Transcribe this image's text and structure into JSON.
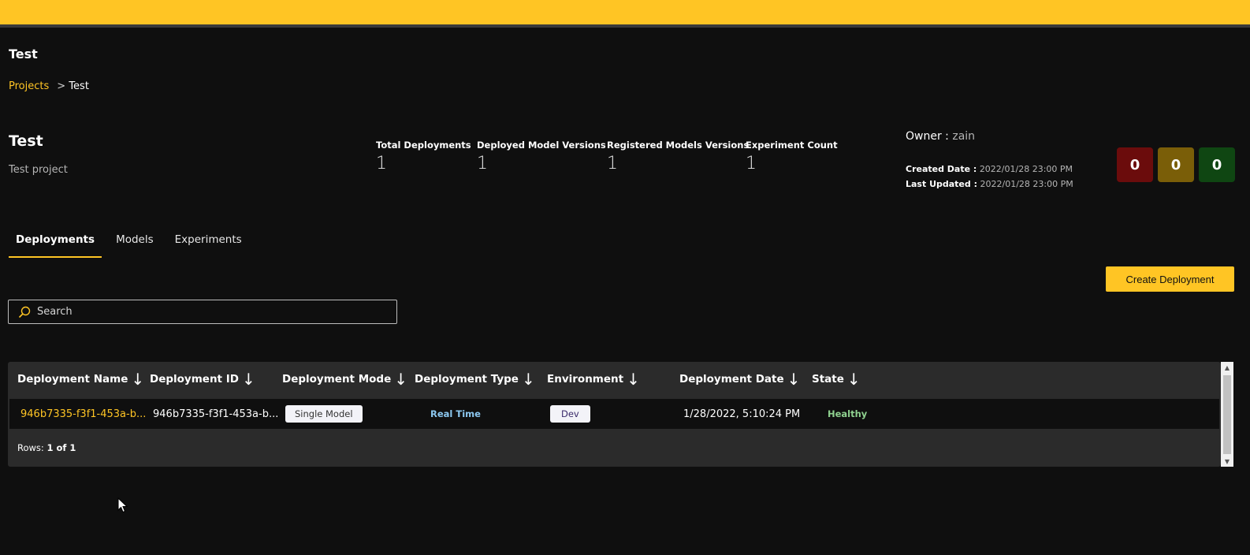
{
  "header": {
    "title": "Test"
  },
  "breadcrumb": {
    "link": "Projects",
    "separator": ">",
    "current": "Test"
  },
  "project": {
    "name": "Test",
    "description": "Test project"
  },
  "stats": [
    {
      "label": "Total Deployments",
      "value": "1"
    },
    {
      "label": "Deployed Model Versions",
      "value": "1"
    },
    {
      "label": "Registered Models Versions",
      "value": "1"
    },
    {
      "label": "Experiment Count",
      "value": "1"
    }
  ],
  "meta": {
    "owner_label": "Owner :",
    "owner_value": "zain",
    "created_label": "Created Date :",
    "created_value": "2022/01/28 23:00 PM",
    "updated_label": "Last Updated :",
    "updated_value": "2022/01/28 23:00 PM"
  },
  "badges": [
    {
      "value": "0",
      "color": "#6b0c0c"
    },
    {
      "value": "0",
      "color": "#7a5e08"
    },
    {
      "value": "0",
      "color": "#0f4612"
    }
  ],
  "tabs": [
    {
      "label": "Deployments",
      "active": true
    },
    {
      "label": "Models",
      "active": false
    },
    {
      "label": "Experiments",
      "active": false
    }
  ],
  "create_button": "Create Deployment",
  "search": {
    "placeholder": "Search"
  },
  "table": {
    "columns": [
      "Deployment Name",
      "Deployment ID",
      "Deployment Mode",
      "Deployment Type",
      "Environment",
      "Deployment Date",
      "State"
    ],
    "rows": [
      {
        "name": "946b7335-f3f1-453a-b...",
        "id": "946b7335-f3f1-453a-b...",
        "mode": "Single Model",
        "type": "Real Time",
        "environment": "Dev",
        "date": "1/28/2022, 5:10:24 PM",
        "state": "Healthy"
      }
    ],
    "rows_label": "Rows:",
    "rows_value": "1 of 1"
  },
  "colors": {
    "accent": "#ffc524",
    "background": "#0f0f0f",
    "table": "#2b2b2b"
  }
}
